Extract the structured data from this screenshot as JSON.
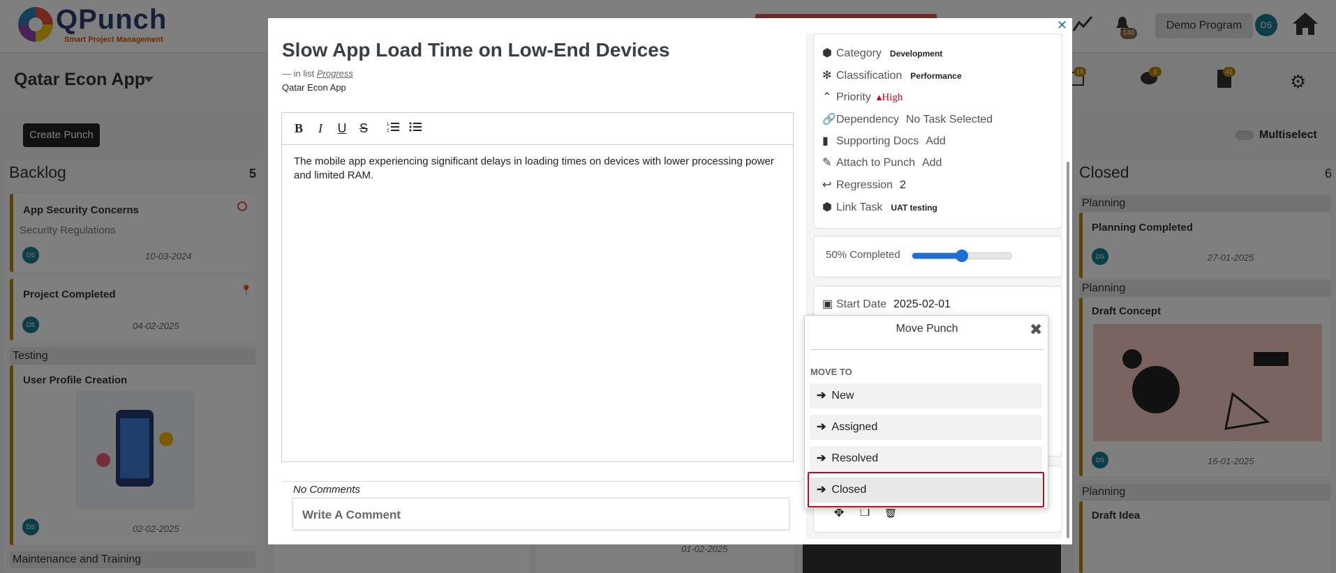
{
  "header": {
    "logo_text": "QPunch",
    "logo_sub": "Smart Project Management",
    "notif_count": "146",
    "program": "Demo Program",
    "user_initials": "DS"
  },
  "toolbar": {
    "project": "Qatar Econ App",
    "create_label": "Create Punch",
    "multiselect_label": "Multiselect",
    "badges": [
      "18",
      "0",
      "41"
    ]
  },
  "columns": {
    "backlog": {
      "name": "Backlog",
      "count": "5",
      "cards": [
        {
          "title": "App Security Concerns",
          "subtitle": "Security Regulations",
          "date": "10-03-2024"
        },
        {
          "title": "Project Completed",
          "date": "04-02-2025"
        },
        {
          "group": "Testing",
          "title": "User Profile Creation",
          "date": "02-02-2025"
        },
        {
          "group": "Maintenance and Training"
        }
      ]
    },
    "closed": {
      "name": "Closed",
      "count": "6",
      "cards": [
        {
          "group": "Planning",
          "title": "Planning Completed",
          "date": "27-01-2025"
        },
        {
          "group": "Planning",
          "title": "Draft Concept",
          "date": "16-01-2025"
        },
        {
          "group": "Planning",
          "title": "Draft Idea"
        }
      ]
    },
    "bottom_dates": [
      "01-02-2025"
    ]
  },
  "modal": {
    "title": "Slow App Load Time on Low-End Devices",
    "in_list_prefix": "— in list",
    "in_list_link": "Progress",
    "project": "Qatar Econ App",
    "description": "The mobile app experiencing significant delays in loading times on devices with lower processing power and limited RAM.",
    "no_comments": "No Comments",
    "comment_placeholder": "Write A Comment",
    "details": {
      "category_label": "Category",
      "category_value": "Development",
      "classification_label": "Classification",
      "classification_value": "Performance",
      "priority_label": "Priority",
      "priority_value": "High",
      "dependency_label": "Dependency",
      "dependency_value": "No Task Selected",
      "docs_label": "Supporting Docs",
      "docs_value": "Add",
      "attach_label": "Attach to Punch",
      "attach_value": "Add",
      "regression_label": "Regression",
      "regression_value": "2",
      "link_label": "Link Task",
      "link_value": "UAT testing"
    },
    "progress_label": "50% Completed",
    "progress_value": 0.5,
    "start_label": "Start Date",
    "start_value": "2025-02-01"
  },
  "move_punch": {
    "title": "Move Punch",
    "subtitle": "MOVE TO",
    "options": [
      "New",
      "Assigned",
      "Resolved",
      "Closed"
    ],
    "highlighted": "Closed"
  },
  "colors": {
    "accent": "#1a6fd1",
    "priority_high": "#d0021b",
    "highlight": "#d0021b"
  }
}
